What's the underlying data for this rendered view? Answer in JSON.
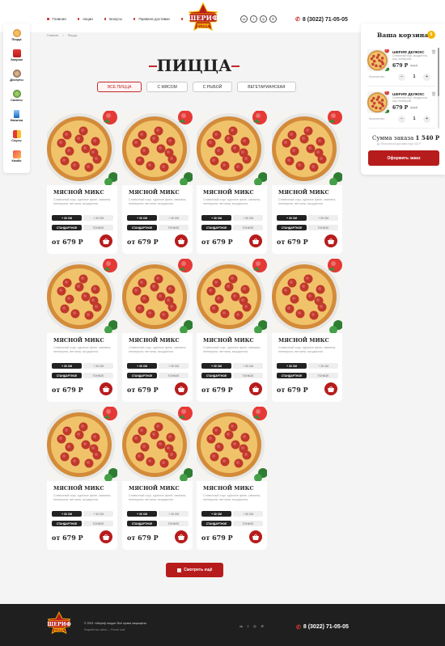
{
  "header": {
    "nav": [
      "Главная",
      "Акции",
      "Бонусы",
      "Правила доставки"
    ],
    "logo_text": "ШЕРИФ",
    "logo_sub": "ПИЦЦА",
    "social": [
      "vk",
      "f",
      "ig",
      "v"
    ],
    "phone": "8 (3022) 71-05-05"
  },
  "sidebar": {
    "items": [
      {
        "label": "Пицца",
        "color": "#e8a24a"
      },
      {
        "label": "Закуски",
        "color": "#c0392b"
      },
      {
        "label": "Десерты",
        "color": "#8d6e63"
      },
      {
        "label": "Салаты",
        "color": "#6d8f3a"
      },
      {
        "label": "Напитки",
        "color": "#4a90c2"
      },
      {
        "label": "Соусы",
        "color": "#d84315"
      },
      {
        "label": "Комбо",
        "color": "#e57373"
      }
    ]
  },
  "breadcrumb": [
    "Главная",
    "/",
    "Пицца"
  ],
  "page_title": "ПИЦЦА",
  "filters": [
    {
      "label": "ВСЕ ПИЦЦА",
      "active": true
    },
    {
      "label": "С МЯСОМ",
      "active": false
    },
    {
      "label": "С РЫБОЙ",
      "active": false
    },
    {
      "label": "ВЕГЕТАРИАНСКАЯ",
      "active": false
    }
  ],
  "products": [
    {
      "name": "МЯСНОЙ МИКС",
      "desc": "Сливочный соус, куриное филе, свинина, пепперони, ветчина, моцарелла",
      "size_a": "+ 30 СМ",
      "size_b": "+ 30 СМ",
      "dough_a": "СТАНДАРТНОЕ",
      "dough_b": "ТОНКОЕ",
      "price": "от 679 Р"
    },
    {
      "name": "МЯСНОЙ МИКС",
      "desc": "Сливочный соус, куриное филе, свинина, пепперони, ветчина, моцарелла",
      "size_a": "+ 30 СМ",
      "size_b": "+ 30 СМ",
      "dough_a": "СТАНДАРТНОЕ",
      "dough_b": "ТОНКОЕ",
      "price": "от 679 Р"
    },
    {
      "name": "МЯСНОЙ МИКС",
      "desc": "Сливочный соус, куриное филе, свинина, пепперони, ветчина, моцарелла",
      "size_a": "+ 30 СМ",
      "size_b": "+ 30 СМ",
      "dough_a": "СТАНДАРТНОЕ",
      "dough_b": "ТОНКОЕ",
      "price": "от 679 Р"
    },
    {
      "name": "МЯСНОЙ МИКС",
      "desc": "Сливочный соус, куриное филе, свинина, пепперони, ветчина, моцарелла",
      "size_a": "+ 30 СМ",
      "size_b": "+ 30 СМ",
      "dough_a": "СТАНДАРТНОЕ",
      "dough_b": "ТОНКОЕ",
      "price": "от 679 Р"
    },
    {
      "name": "МЯСНОЙ МИКС",
      "desc": "Сливочный соус, куриное филе, свинина, пепперони, ветчина, моцарелла",
      "size_a": "+ 30 СМ",
      "size_b": "+ 30 СМ",
      "dough_a": "СТАНДАРТНОЕ",
      "dough_b": "ТОНКОЕ",
      "price": "от 679 Р"
    },
    {
      "name": "МЯСНОЙ МИКС",
      "desc": "Сливочный соус, куриное филе, свинина, пепперони, ветчина, моцарелла",
      "size_a": "+ 30 СМ",
      "size_b": "+ 30 СМ",
      "dough_a": "СТАНДАРТНОЕ",
      "dough_b": "ТОНКОЕ",
      "price": "от 679 Р"
    },
    {
      "name": "МЯСНОЙ МИКС",
      "desc": "Сливочный соус, куриное филе, свинина, пепперони, ветчина, моцарелла",
      "size_a": "+ 30 СМ",
      "size_b": "+ 30 СМ",
      "dough_a": "СТАНДАРТНОЕ",
      "dough_b": "ТОНКОЕ",
      "price": "от 679 Р"
    },
    {
      "name": "МЯСНОЙ МИКС",
      "desc": "Сливочный соус, куриное филе, свинина, пепперони, ветчина, моцарелла",
      "size_a": "+ 30 СМ",
      "size_b": "+ 30 СМ",
      "dough_a": "СТАНДАРТНОЕ",
      "dough_b": "ТОНКОЕ",
      "price": "от 679 Р"
    },
    {
      "name": "МЯСНОЙ МИКС",
      "desc": "Сливочный соус, куриное филе, свинина, пепперони, ветчина, моцарелла",
      "size_a": "+ 30 СМ",
      "size_b": "+ 30 СМ",
      "dough_a": "СТАНДАРТНОЕ",
      "dough_b": "ТОНКОЕ",
      "price": "от 679 Р"
    },
    {
      "name": "МЯСНОЙ МИКС",
      "desc": "Сливочный соус, куриное филе, свинина, пепперони, ветчина, моцарелла",
      "size_a": "+ 30 СМ",
      "size_b": "+ 30 СМ",
      "dough_a": "СТАНДАРТНОЕ",
      "dough_b": "ТОНКОЕ",
      "price": "от 679 Р"
    },
    {
      "name": "МЯСНОЙ МИКС",
      "desc": "Сливочный соус, куриное филе, свинина, пепперони, ветчина, моцарелла",
      "size_a": "+ 30 СМ",
      "size_b": "+ 30 СМ",
      "dough_a": "СТАНДАРТНОЕ",
      "dough_b": "ТОНКОЕ",
      "price": "от 679 Р"
    }
  ],
  "more_button": "Смотреть ещё",
  "basket": {
    "title": "Ваша корзина",
    "count": "6",
    "items": [
      {
        "name": "ШЕРИФ ДЕЛЮКС",
        "desc": "Сливочный соус, моцарелла, сыр, пепперони",
        "price": "679 Р",
        "old_price": "970 Р",
        "qty_label": "Количество:",
        "qty": "1"
      },
      {
        "name": "ШЕРИФ ДЕЛЮКС",
        "desc": "Сливочный соус, моцарелла, сыр, пепперони",
        "price": "679 Р",
        "old_price": "970 Р",
        "qty_label": "Количество:",
        "qty": "1"
      }
    ],
    "sum_label": "Сумма заказа",
    "sum_value": "1 540 Р",
    "sum_note": "До бесплатной доставки ещё 410 Р",
    "order_button": "Оформить заказ"
  },
  "footer": {
    "copyright": "© 2021 «Шериф пицца» Все права защищены",
    "developer": "Разработка сайта — Ferrari kudi",
    "social": [
      "vk",
      "f",
      "ig",
      "v"
    ],
    "phone": "8 (3022) 71-05-05"
  }
}
